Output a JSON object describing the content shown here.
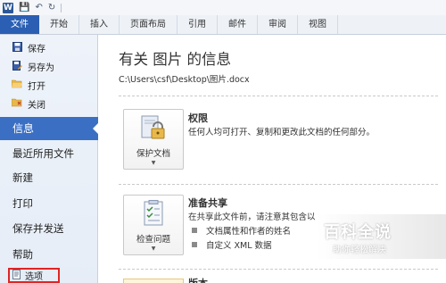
{
  "qat": {
    "app_icon": "word-icon",
    "app_letter": "W",
    "icons": [
      "save-icon",
      "undo-icon",
      "redo-icon"
    ]
  },
  "ribbon": {
    "file_tab": "文件",
    "tabs": [
      "开始",
      "插入",
      "页面布局",
      "引用",
      "邮件",
      "审阅",
      "视图"
    ]
  },
  "nav": {
    "small_items": [
      {
        "label": "保存",
        "icon": "save-icon"
      },
      {
        "label": "另存为",
        "icon": "save-as-icon"
      },
      {
        "label": "打开",
        "icon": "open-folder-icon"
      },
      {
        "label": "关闭",
        "icon": "close-folder-icon"
      }
    ],
    "selected": "信息",
    "big_items": [
      "最近所用文件",
      "新建",
      "打印",
      "保存并发送",
      "帮助"
    ],
    "options": "选项"
  },
  "main": {
    "title": "有关 图片 的信息",
    "path": "C:\\Users\\csf\\Desktop\\图片.docx",
    "sections": [
      {
        "tile_label": "保护文档",
        "title": "权限",
        "desc": "任何人均可打开、复制和更改此文档的任何部分。"
      },
      {
        "tile_label": "检查问题",
        "title": "准备共享",
        "desc": "在共享此文件前，请注意其包含以",
        "bullets": [
          "文档属性和作者的姓名",
          "自定义 XML 数据"
        ]
      },
      {
        "title": "版本"
      }
    ]
  },
  "watermark": {
    "title": "百科全说",
    "subtitle": "助你轻松解决"
  },
  "colors": {
    "file_tab": "#2b5fb3",
    "nav_selected": "#3a6fc4",
    "options_highlight": "#e02424"
  }
}
